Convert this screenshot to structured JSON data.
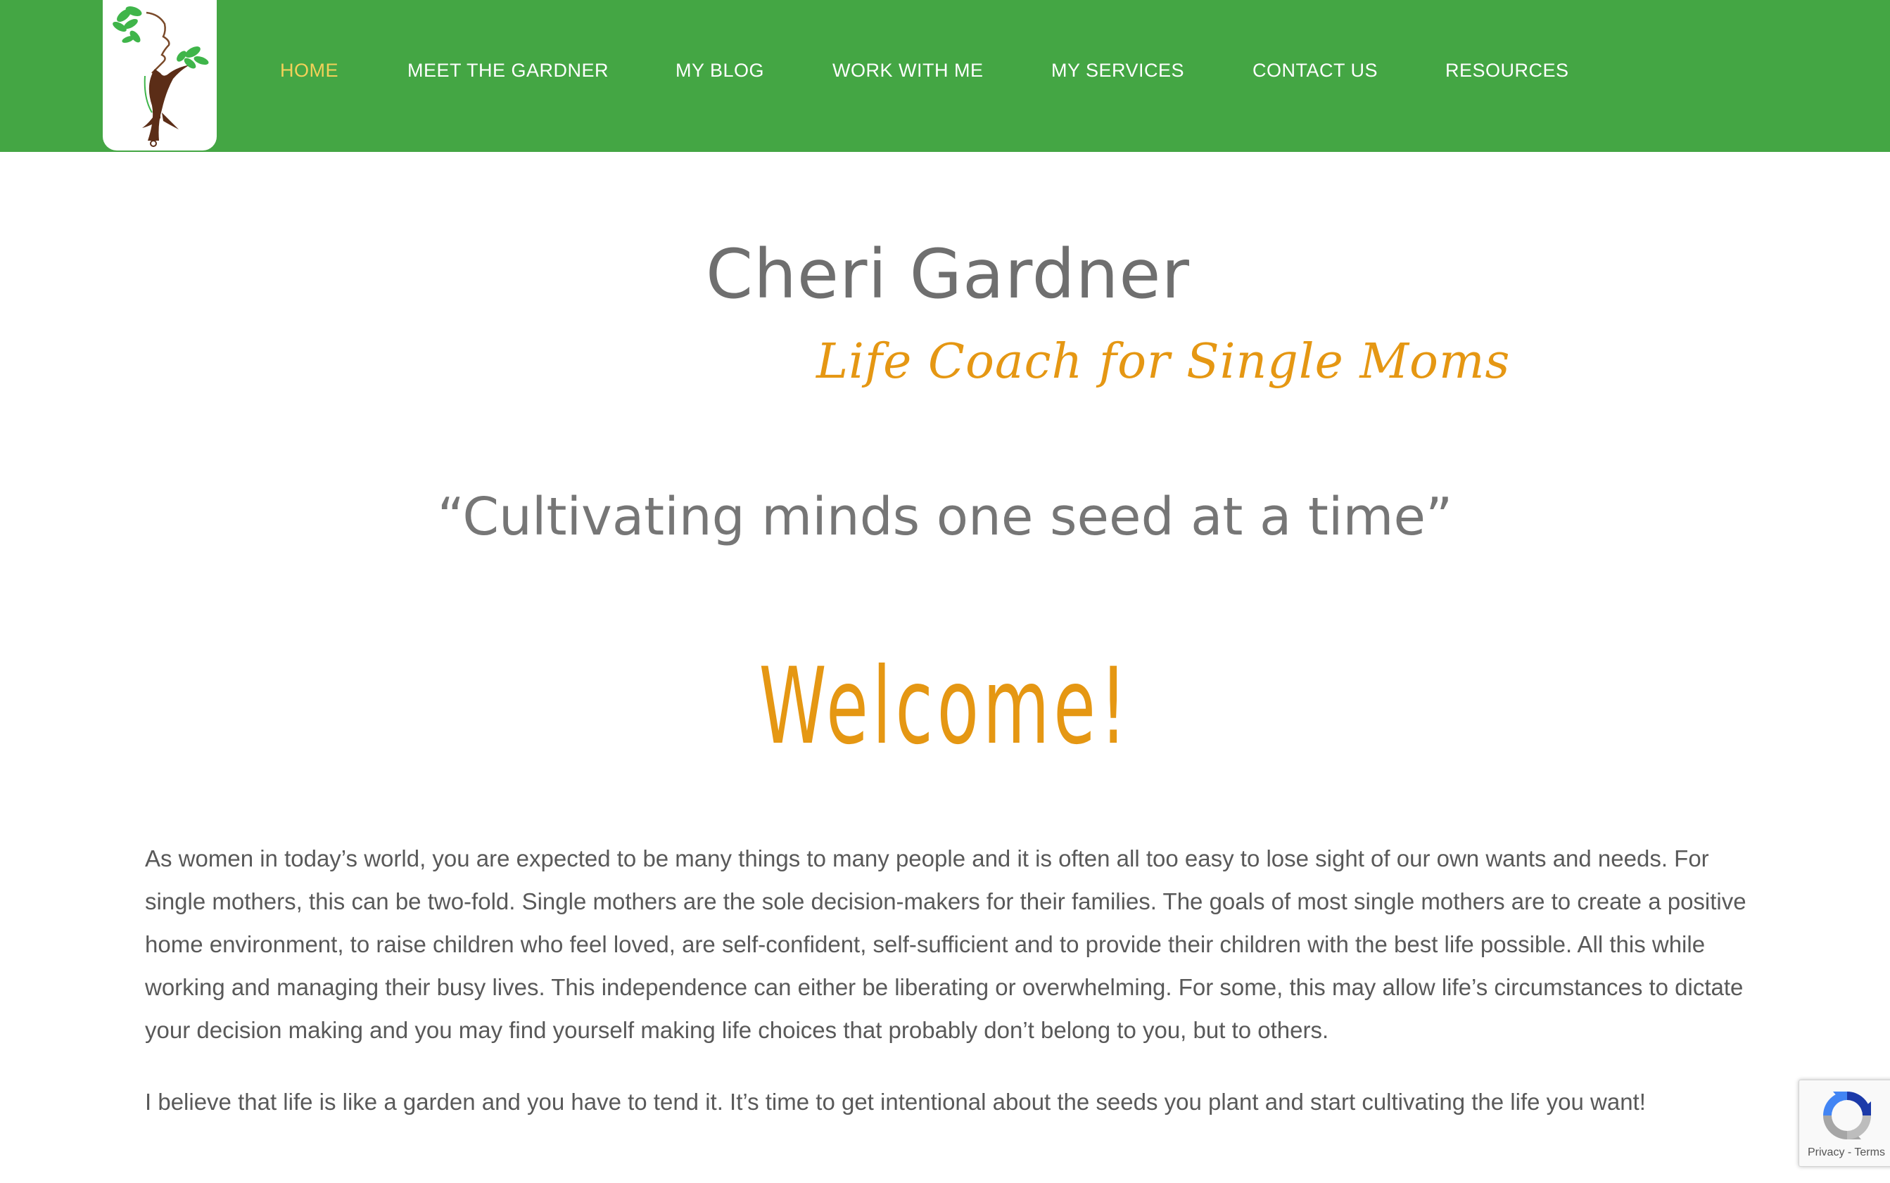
{
  "colors": {
    "header_bg": "#44a644",
    "nav_text": "#ffffff",
    "nav_active": "#f3d159",
    "accent_orange": "#e59713",
    "heading_gray": "#6f6f6f",
    "body_text": "#595959"
  },
  "header": {
    "logo_icon": "tree-woman-logo-icon",
    "nav": [
      {
        "label": "HOME",
        "active": true
      },
      {
        "label": "MEET THE GARDNER",
        "active": false
      },
      {
        "label": "MY BLOG",
        "active": false
      },
      {
        "label": "WORK WITH ME",
        "active": false
      },
      {
        "label": "MY SERVICES",
        "active": false
      },
      {
        "label": "CONTACT US",
        "active": false
      },
      {
        "label": "RESOURCES",
        "active": false
      }
    ]
  },
  "hero": {
    "site_name": "Cheri Gardner",
    "tagline": "Life Coach  for Single Moms",
    "motto": "“Cultivating minds one seed at a time”",
    "welcome": "Welcome!"
  },
  "content": {
    "paragraphs": [
      "As women in today’s world, you are expected to be many things to many people and it is often all too easy to lose sight of our own wants and needs. For single mothers, this can be two-fold. Single mothers are the sole decision-makers for their families. The goals of most single mothers are to create a positive home environment, to raise children who feel loved, are self-confident, self-sufficient and to provide their children with the best life possible. All this while working and managing their busy lives. This independence can either be liberating or overwhelming. For some, this may allow life’s circumstances to dictate your decision making and you may find yourself making life choices that probably don’t belong to you, but to others.",
      "I believe that life is like a garden and you have to tend it.  It’s time to get intentional about the seeds you plant and start cultivating the life you want!"
    ]
  },
  "recaptcha": {
    "icon": "recaptcha-icon",
    "privacy_label": "Privacy",
    "separator": " - ",
    "terms_label": "Terms"
  }
}
